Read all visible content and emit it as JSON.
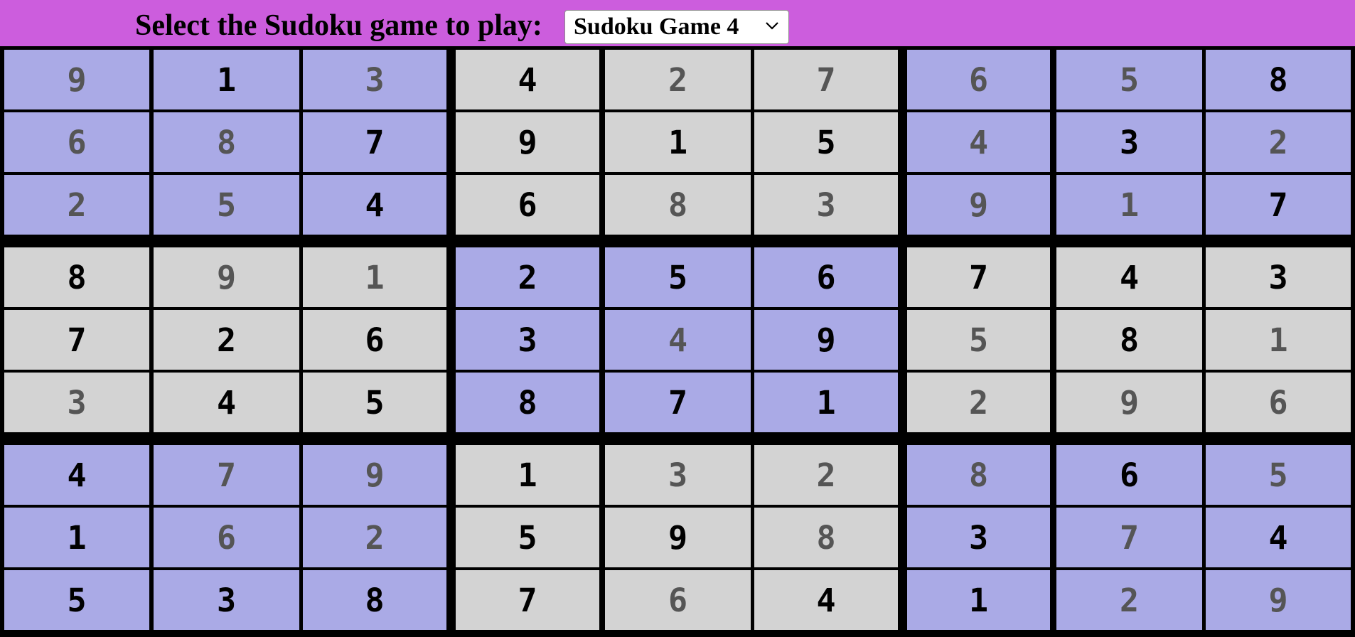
{
  "header": {
    "prompt": "Select the Sudoku game to play:",
    "selected_game": "Sudoku Game 4"
  },
  "colors": {
    "header_bg": "#cc5ddd",
    "box_purple": "#aaaae6",
    "box_gray": "#d3d3d3",
    "given_digit": "#000000",
    "entered_digit": "#555555",
    "grid_lines": "#000000"
  },
  "board": {
    "rows": [
      [
        9,
        1,
        3,
        4,
        2,
        7,
        6,
        5,
        8
      ],
      [
        6,
        8,
        7,
        9,
        1,
        5,
        4,
        3,
        2
      ],
      [
        2,
        5,
        4,
        6,
        8,
        3,
        9,
        1,
        7
      ],
      [
        8,
        9,
        1,
        2,
        5,
        6,
        7,
        4,
        3
      ],
      [
        7,
        2,
        6,
        3,
        4,
        9,
        5,
        8,
        1
      ],
      [
        3,
        4,
        5,
        8,
        7,
        1,
        2,
        9,
        6
      ],
      [
        4,
        7,
        9,
        1,
        3,
        2,
        8,
        6,
        5
      ],
      [
        1,
        6,
        2,
        5,
        9,
        8,
        3,
        7,
        4
      ],
      [
        5,
        3,
        8,
        7,
        6,
        4,
        1,
        2,
        9
      ]
    ],
    "given": [
      [
        0,
        1,
        0,
        1,
        0,
        0,
        0,
        0,
        1
      ],
      [
        0,
        0,
        1,
        1,
        1,
        1,
        0,
        1,
        0
      ],
      [
        0,
        0,
        1,
        1,
        0,
        0,
        0,
        0,
        1
      ],
      [
        1,
        0,
        0,
        1,
        1,
        1,
        1,
        1,
        1
      ],
      [
        1,
        1,
        1,
        1,
        0,
        1,
        0,
        1,
        0
      ],
      [
        0,
        1,
        1,
        1,
        1,
        1,
        0,
        0,
        0
      ],
      [
        1,
        0,
        0,
        1,
        0,
        0,
        0,
        1,
        0
      ],
      [
        1,
        0,
        0,
        1,
        1,
        0,
        1,
        0,
        1
      ],
      [
        1,
        1,
        1,
        1,
        0,
        1,
        1,
        0,
        0
      ]
    ]
  }
}
